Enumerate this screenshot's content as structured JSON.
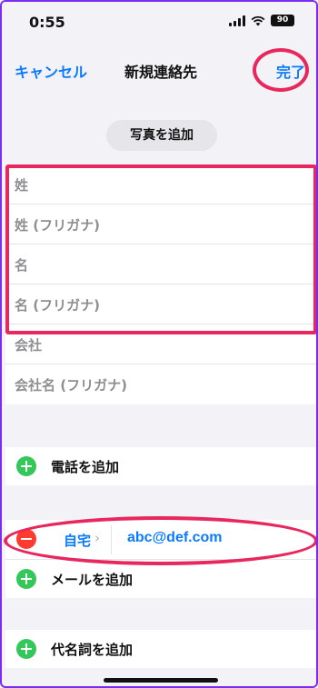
{
  "status_bar": {
    "time": "0:55",
    "battery": "90"
  },
  "nav": {
    "cancel": "キャンセル",
    "title": "新規連絡先",
    "done": "完了"
  },
  "photo": {
    "add_label": "写真を追加"
  },
  "name_fields": [
    {
      "placeholder": "姓"
    },
    {
      "placeholder": "姓 (フリガナ)"
    },
    {
      "placeholder": "名"
    },
    {
      "placeholder": "名 (フリガナ)"
    },
    {
      "placeholder": "会社"
    },
    {
      "placeholder": "会社名 (フリガナ)"
    }
  ],
  "phone": {
    "add_label": "電話を追加"
  },
  "email": {
    "type": "自宅",
    "chevron": "›",
    "value": "abc@def.com",
    "add_label": "メールを追加"
  },
  "pronoun": {
    "add_label": "代名詞を追加"
  },
  "colors": {
    "accent": "#0a7aff",
    "add_green": "#34c759",
    "remove_red": "#ff3b30",
    "annotation": "#e8275f"
  }
}
